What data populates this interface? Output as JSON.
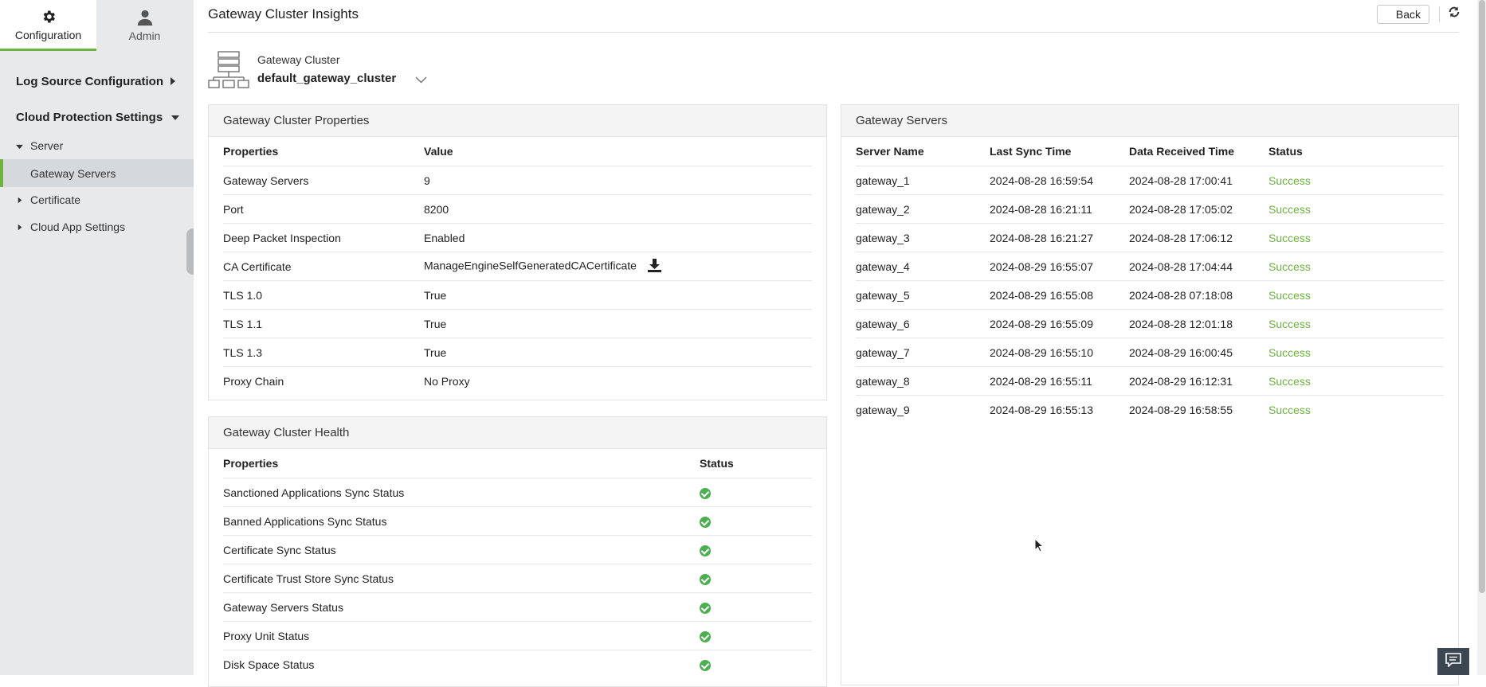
{
  "sidebar": {
    "tabs": [
      {
        "label": "Configuration",
        "icon": "gear-icon",
        "active": true
      },
      {
        "label": "Admin",
        "icon": "user-icon",
        "active": false
      }
    ],
    "sections": [
      {
        "label": "Log Source Configuration",
        "expanded": false
      },
      {
        "label": "Cloud Protection Settings",
        "expanded": true
      }
    ],
    "items": {
      "server": "Server",
      "gateway_servers": "Gateway Servers",
      "certificate": "Certificate",
      "cloud_app_settings": "Cloud App Settings"
    }
  },
  "header": {
    "title": "Gateway Cluster Insights",
    "back_label": "Back"
  },
  "cluster": {
    "caption": "Gateway Cluster",
    "name": "default_gateway_cluster"
  },
  "properties_panel": {
    "title": "Gateway Cluster Properties",
    "columns": [
      "Properties",
      "Value"
    ],
    "rows": [
      {
        "property": "Gateway Servers",
        "value": "9"
      },
      {
        "property": "Port",
        "value": "8200"
      },
      {
        "property": "Deep Packet Inspection",
        "value": "Enabled"
      },
      {
        "property": "CA Certificate",
        "value": "ManageEngineSelfGeneratedCACertificate"
      },
      {
        "property": "TLS 1.0",
        "value": "True"
      },
      {
        "property": "TLS 1.1",
        "value": "True"
      },
      {
        "property": "TLS 1.3",
        "value": "True"
      },
      {
        "property": "Proxy Chain",
        "value": "No Proxy"
      }
    ]
  },
  "health_panel": {
    "title": "Gateway Cluster Health",
    "columns": [
      "Properties",
      "Status"
    ],
    "rows": [
      {
        "property": "Sanctioned Applications Sync Status",
        "status": "ok"
      },
      {
        "property": "Banned Applications Sync Status",
        "status": "ok"
      },
      {
        "property": "Certificate Sync Status",
        "status": "ok"
      },
      {
        "property": "Certificate Trust Store Sync Status",
        "status": "ok"
      },
      {
        "property": "Gateway Servers Status",
        "status": "ok"
      },
      {
        "property": "Proxy Unit Status",
        "status": "ok"
      },
      {
        "property": "Disk Space Status",
        "status": "ok"
      }
    ]
  },
  "servers_panel": {
    "title": "Gateway Servers",
    "columns": [
      "Server Name",
      "Last Sync Time",
      "Data Received Time",
      "Status"
    ],
    "rows": [
      [
        "gateway_1",
        "2024-08-28 16:59:54",
        "2024-08-28 17:00:41",
        "Success"
      ],
      [
        "gateway_2",
        "2024-08-28 16:21:11",
        "2024-08-28 17:05:02",
        "Success"
      ],
      [
        "gateway_3",
        "2024-08-28 16:21:27",
        "2024-08-28 17:06:12",
        "Success"
      ],
      [
        "gateway_4",
        "2024-08-29 16:55:07",
        "2024-08-28 17:04:44",
        "Success"
      ],
      [
        "gateway_5",
        "2024-08-29 16:55:08",
        "2024-08-28 07:18:08",
        "Success"
      ],
      [
        "gateway_6",
        "2024-08-29 16:55:09",
        "2024-08-28 12:01:18",
        "Success"
      ],
      [
        "gateway_7",
        "2024-08-29 16:55:10",
        "2024-08-29 16:00:45",
        "Success"
      ],
      [
        "gateway_8",
        "2024-08-29 16:55:11",
        "2024-08-29 16:12:31",
        "Success"
      ],
      [
        "gateway_9",
        "2024-08-29 16:55:13",
        "2024-08-29 16:58:55",
        "Success"
      ]
    ]
  },
  "colors": {
    "accent": "#6db33f",
    "success": "#6db33f",
    "sidebar_bg": "#e7e9ea"
  }
}
